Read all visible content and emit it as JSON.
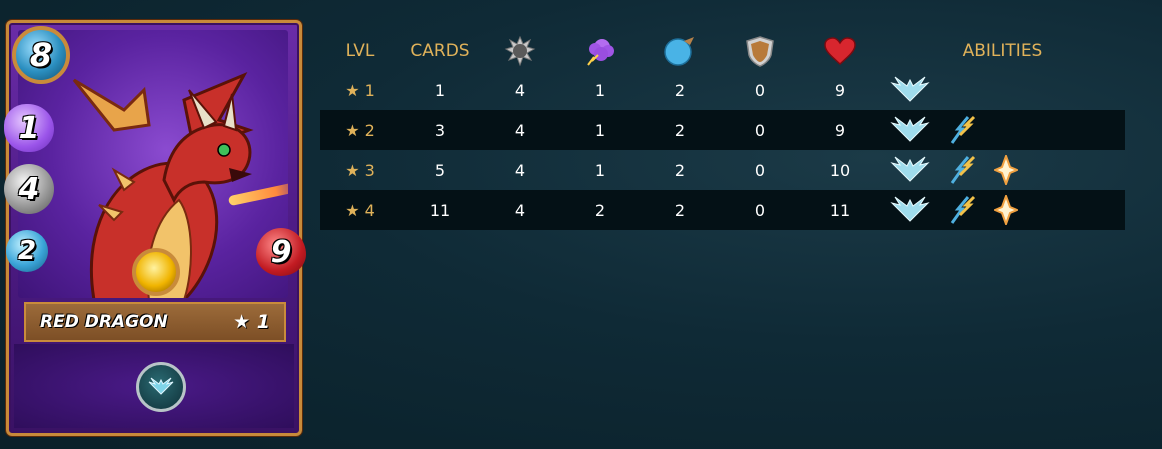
{
  "card": {
    "name": "RED DRAGON",
    "level": "★ 1",
    "mana": "8",
    "magic": "1",
    "attack": "4",
    "speed": "2",
    "health": "9",
    "element": "fire",
    "ability_icon": "flying-icon",
    "colors": {
      "frame": "#c88a3a",
      "background": "#5a23a0",
      "dragon": "#c8302a"
    }
  },
  "table": {
    "headers": {
      "lvl": "LVL",
      "cards": "CARDS",
      "melee_icon": "melee-attack-icon",
      "magic_icon": "magic-attack-icon",
      "speed_icon": "speed-icon",
      "armor_icon": "armor-icon",
      "health_icon": "health-icon",
      "abilities": "ABILITIES"
    },
    "rows": [
      {
        "level": "1",
        "cards": "1",
        "melee": "4",
        "magic": "1",
        "speed": "2",
        "armor": "0",
        "health": "9",
        "abilities": [
          "flying"
        ]
      },
      {
        "level": "2",
        "cards": "3",
        "melee": "4",
        "magic": "1",
        "speed": "2",
        "armor": "0",
        "health": "9",
        "abilities": [
          "flying",
          "magic-reflect"
        ]
      },
      {
        "level": "3",
        "cards": "5",
        "melee": "4",
        "magic": "1",
        "speed": "2",
        "armor": "0",
        "health": "10",
        "abilities": [
          "flying",
          "magic-reflect",
          "divine-shield"
        ]
      },
      {
        "level": "4",
        "cards": "11",
        "melee": "4",
        "magic": "2",
        "speed": "2",
        "armor": "0",
        "health": "11",
        "abilities": [
          "flying",
          "magic-reflect",
          "divine-shield"
        ]
      }
    ],
    "star": "★"
  },
  "colors": {
    "accent": "#e0b25a",
    "row_alt": "#041116",
    "background": "#0f2a36"
  }
}
